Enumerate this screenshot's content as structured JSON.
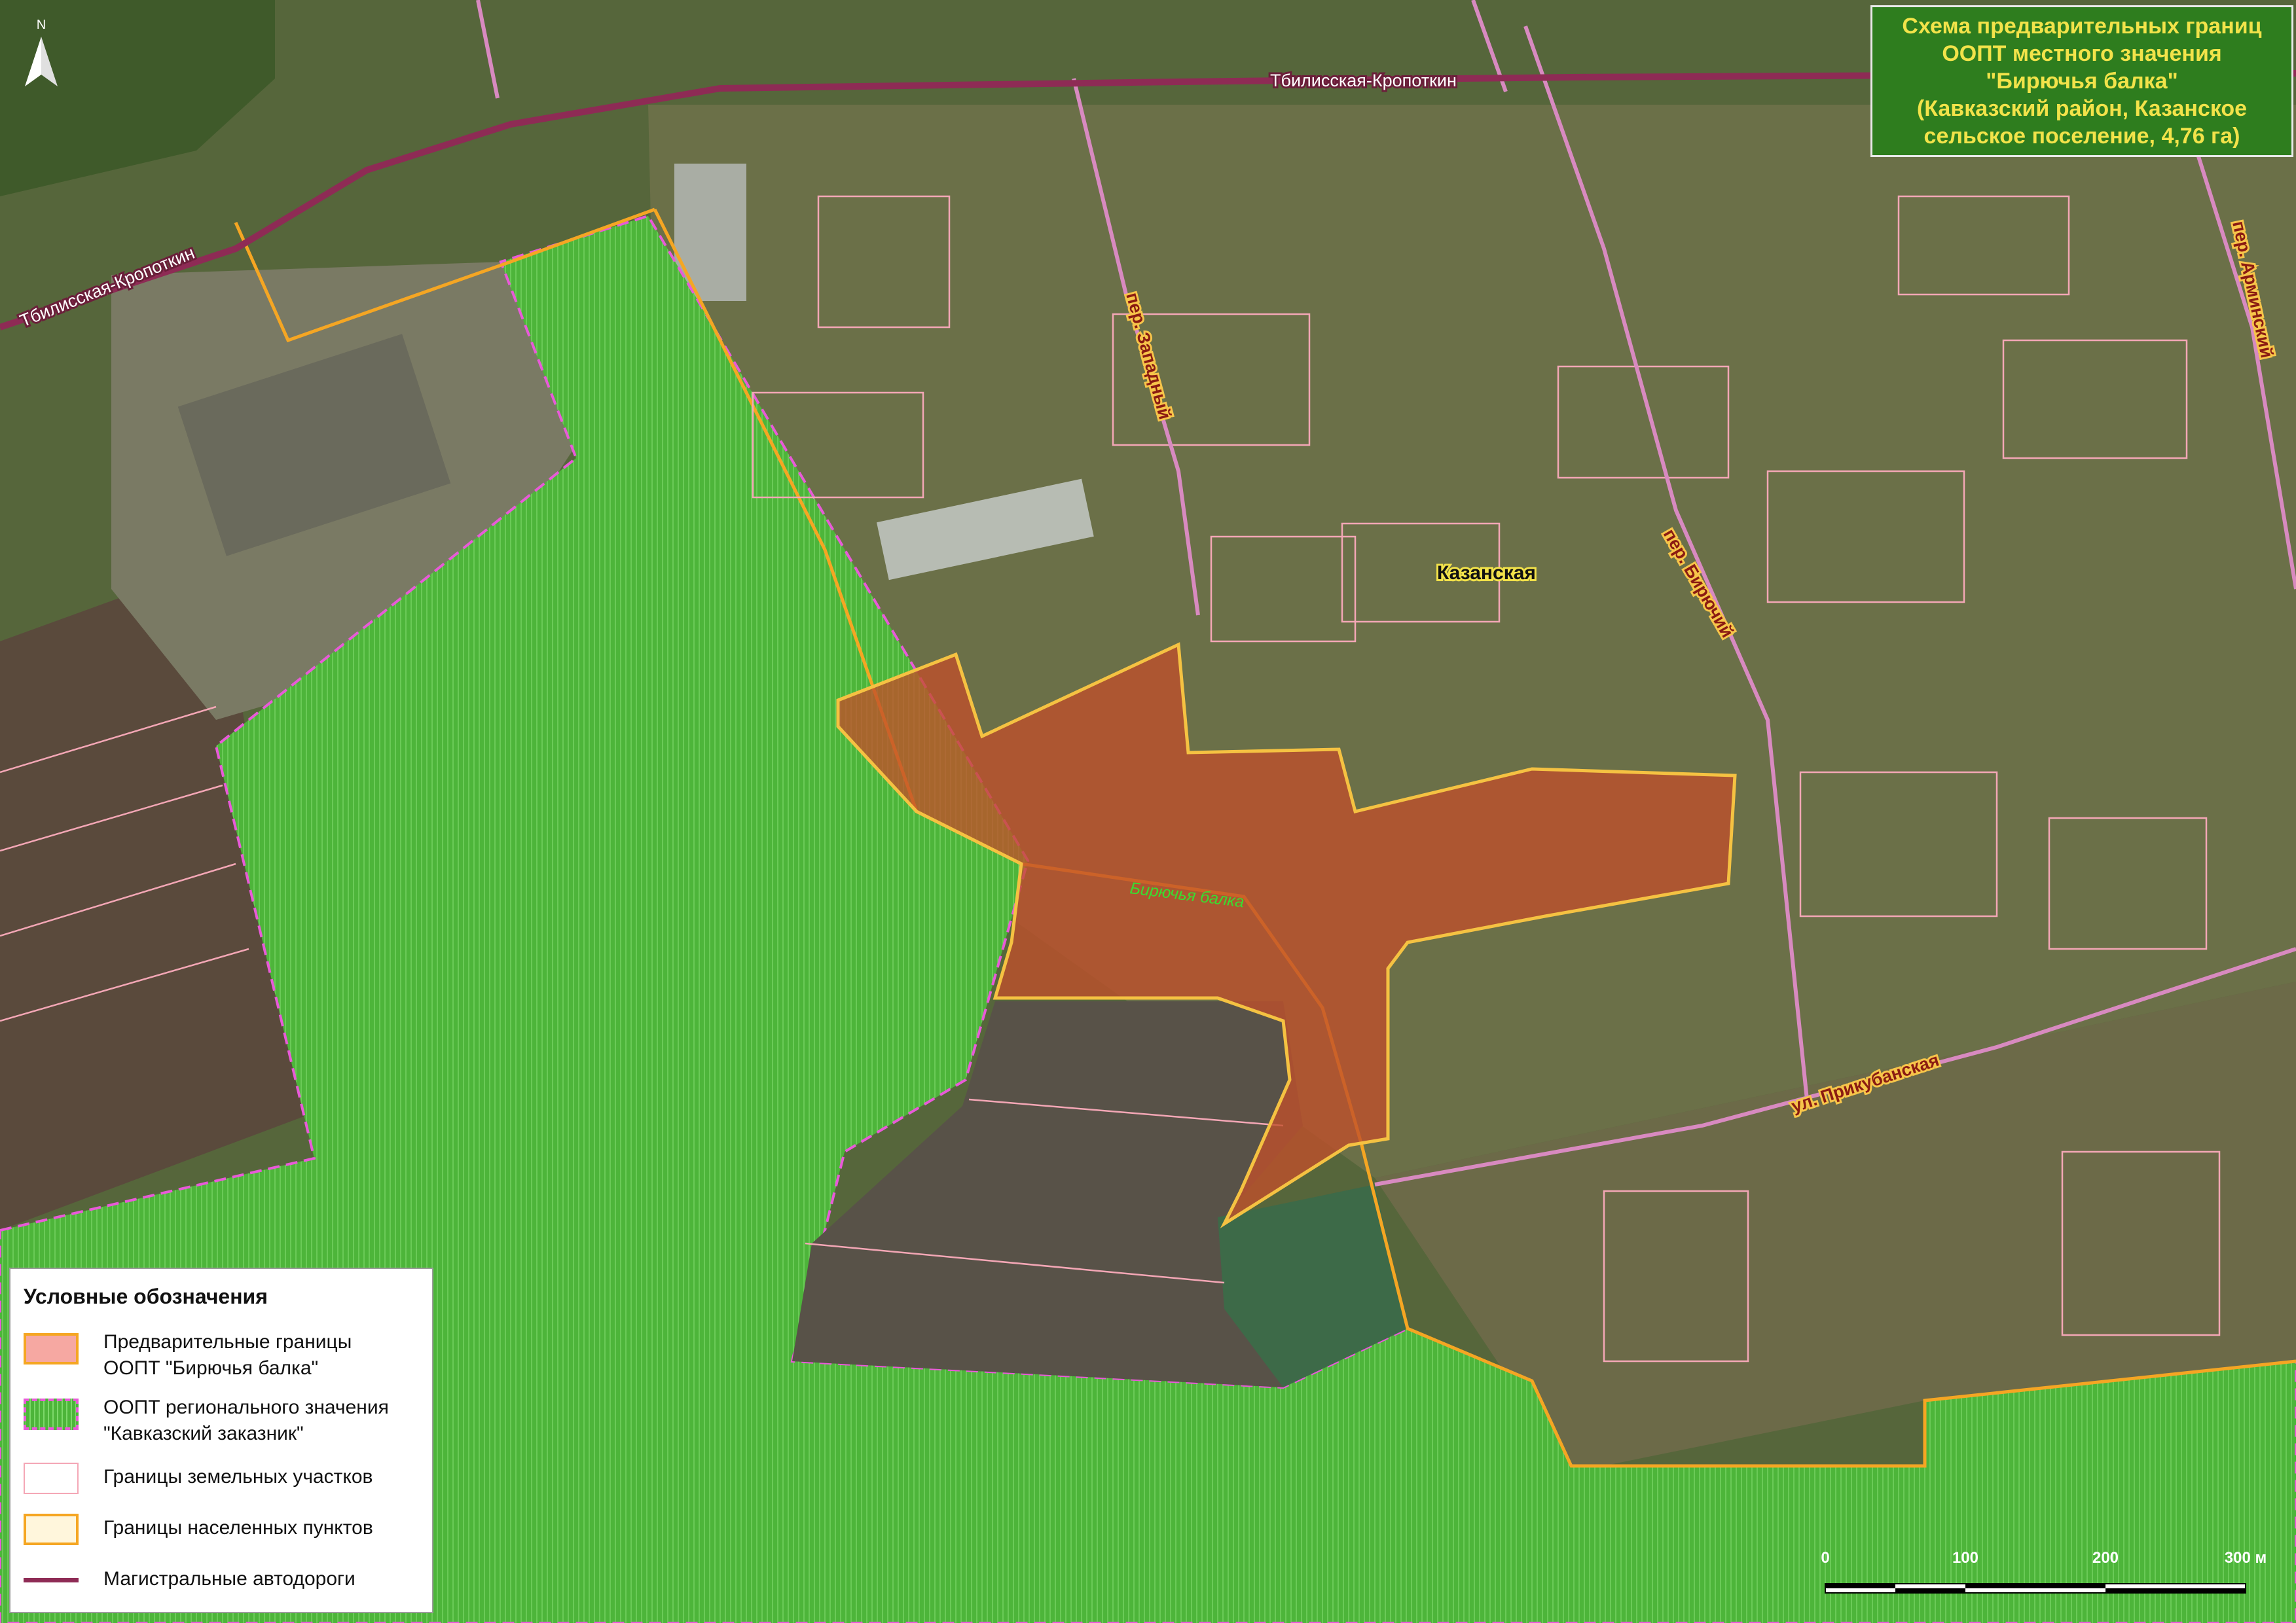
{
  "title": {
    "lines": [
      "Схема предварительных границ",
      "ООПТ местного значения",
      "\"Бирючья балка\"",
      "(Кавказский район, Казанское",
      "сельское поселение, 4,76 га)"
    ]
  },
  "north_arrow": {
    "letter": "N"
  },
  "labels": {
    "road_main_1": "Тбилисская-Кропоткин",
    "road_main_2": "Тбилисская-Кропоткин",
    "street_zapadny": "пер. Западный",
    "street_biryuchy": "пер. Бирючий",
    "street_arminsky": "пер. Арминский",
    "street_prikubanskaya": "ул. Прикубанская",
    "village": "Казанская",
    "ravine": "Бирючья балка"
  },
  "legend": {
    "title": "Условные обозначения",
    "items": [
      {
        "line1": "Предварительные границы",
        "line2": "ООПТ \"Бирючья балка\"",
        "swatch": "oopt-local"
      },
      {
        "line1": "ООПТ регионального значения",
        "line2": "\"Кавказский заказник\"",
        "swatch": "oopt-regional"
      },
      {
        "line1": "Границы земельных участков",
        "line2": "",
        "swatch": "parcels"
      },
      {
        "line1": "Границы населенных пунктов",
        "line2": "",
        "swatch": "settlement"
      },
      {
        "line1": "Магистральные автодороги",
        "line2": "",
        "swatch": "highway"
      }
    ]
  },
  "scale": {
    "ticks": [
      "0",
      "100",
      "200",
      "300 м"
    ]
  },
  "colors": {
    "title_bg": "#2e7d1e",
    "title_text": "#f2e34a",
    "oopt_local_fill": "#c0502a",
    "oopt_local_stroke": "#f5c242",
    "oopt_regional_fill": "#4fbf3a",
    "oopt_regional_stroke": "#e85ad8",
    "parcel_stroke": "#f4a7b6",
    "settlement_stroke": "#f5a623",
    "highway": "#8e2b55"
  }
}
